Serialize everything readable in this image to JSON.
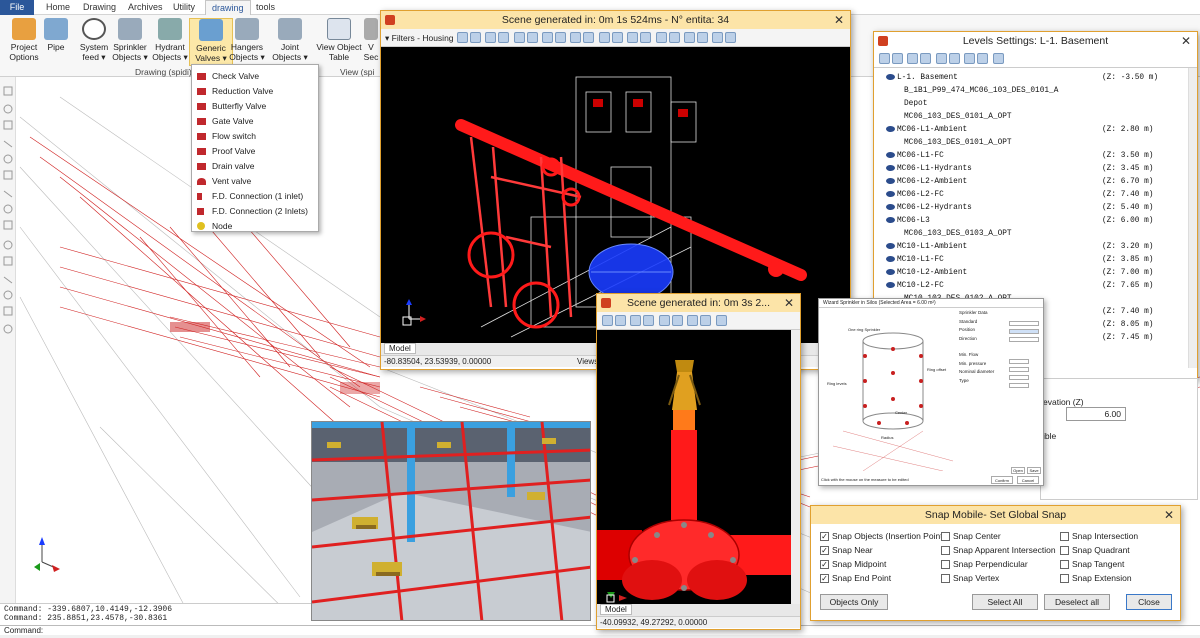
{
  "menubar": {
    "file": "File",
    "tabs": [
      "Home",
      "Drawing",
      "Archives",
      "Utility",
      "drawing",
      "tools"
    ]
  },
  "ribbon": {
    "buttons": [
      {
        "label": "Project Options"
      },
      {
        "label": "Pipe"
      },
      {
        "label": "System feed ▾"
      },
      {
        "label": "Sprinkler Objects ▾"
      },
      {
        "label": "Hydrant Objects ▾"
      },
      {
        "label": "Generic Valves ▾"
      },
      {
        "label": "Hangers Objects ▾"
      },
      {
        "label": "Joint Objects ▾"
      },
      {
        "label": "View Object Table"
      },
      {
        "label": "V Sec"
      }
    ],
    "group_label": "Drawing (spidi)",
    "group_label2": "View (spi"
  },
  "dropdown": {
    "items": [
      "Check Valve",
      "Reduction Valve",
      "Butterfly Valve",
      "Gate Valve",
      "Flow switch",
      "Proof Valve",
      "Drain valve",
      "Vent valve",
      "F.D. Connection (1 inlet)",
      "F.D. Connection (2 Inlets)",
      "Node"
    ]
  },
  "scene1": {
    "title": "Scene generated in: 0m 1s 524ms - N° entita: 34",
    "filter": "Filters - Housing",
    "tab": "Model",
    "coords": "-80.83504, 23.53939, 0.00000",
    "views": "Views"
  },
  "scene2": {
    "title": "Scene generated in: 0m 3s 2...",
    "tab": "Model",
    "coords": "-40.09932, 49.27292, 0.00000"
  },
  "levels": {
    "title": "Levels Settings: L-1. Basement",
    "rows": [
      {
        "name": "L-1. Basement",
        "z": "(Z: -3.50 m)"
      },
      {
        "name": "B_1B1_P99_474_MC06_103_DES_0101_A",
        "z": ""
      },
      {
        "name": "Depot",
        "z": ""
      },
      {
        "name": "MC06_103_DES_0101_A_OPT",
        "z": ""
      },
      {
        "name": "MC06-L1-Ambient",
        "z": "(Z:  2.80 m)"
      },
      {
        "name": "MC06_103_DES_0101_A_OPT",
        "z": ""
      },
      {
        "name": "MC06-L1-FC",
        "z": "(Z:  3.50 m)"
      },
      {
        "name": "MC06-L1-Hydrants",
        "z": "(Z:  3.45 m)"
      },
      {
        "name": "MC06-L2-Ambient",
        "z": "(Z:  6.70 m)"
      },
      {
        "name": "MC06-L2-FC",
        "z": "(Z:  7.40 m)"
      },
      {
        "name": "MC06-L2-Hydrants",
        "z": "(Z:  5.40 m)"
      },
      {
        "name": "MC06-L3",
        "z": "(Z:  6.00 m)"
      },
      {
        "name": "MC06_103_DES_0103_A_OPT",
        "z": ""
      },
      {
        "name": "MC10-L1-Ambient",
        "z": "(Z:  3.20 m)"
      },
      {
        "name": "MC10-L1-FC",
        "z": "(Z:  3.85 m)"
      },
      {
        "name": "MC10-L2-Ambient",
        "z": "(Z:  7.00 m)"
      },
      {
        "name": "MC10-L2-FC",
        "z": "(Z:  7.65 m)"
      },
      {
        "name": "MC10_103_DES_0102_A_OPT",
        "z": ""
      },
      {
        "name": "",
        "z": "(Z:  7.40 m)"
      },
      {
        "name": "",
        "z": "(Z:  8.05 m)"
      },
      {
        "name": "",
        "z": "(Z:  7.45 m)"
      }
    ],
    "elevation_label": "evation (Z)",
    "elevation_value": "6.00",
    "visible_label": "ible"
  },
  "wizard": {
    "title": "Wizard Sprinkler in Silos (Selected Area = 6.00 m²)",
    "fields": [
      "Sprinkler Data",
      "Standard",
      "Position",
      "Direction",
      "Min. Flow",
      "Min. pressure",
      "Nominal diameter",
      "Type"
    ],
    "hint": "Click with the mouse on the measure to be edited",
    "buttons": [
      "Open",
      "Save",
      "Confirm",
      "Cancel"
    ],
    "labels": [
      "One ring Sprinkler",
      "Ring offset",
      "Ring levels",
      "Center",
      "Radius"
    ]
  },
  "snap": {
    "title": "Snap Mobile- Set Global Snap",
    "options": [
      {
        "label": "Snap Objects (Insertion Point)",
        "checked": true
      },
      {
        "label": "Snap Near",
        "checked": true
      },
      {
        "label": "Snap Midpoint",
        "checked": true
      },
      {
        "label": "Snap End Point",
        "checked": true
      },
      {
        "label": "Snap Center",
        "checked": false
      },
      {
        "label": "Snap Apparent Intersection",
        "checked": false
      },
      {
        "label": "Snap Perpendicular",
        "checked": false
      },
      {
        "label": "Snap Vertex",
        "checked": false
      },
      {
        "label": "Snap Intersection",
        "checked": false
      },
      {
        "label": "Snap Quadrant",
        "checked": false
      },
      {
        "label": "Snap Tangent",
        "checked": false
      },
      {
        "label": "Snap Extension",
        "checked": false
      }
    ],
    "btn_objects_only": "Objects Only",
    "btn_select_all": "Select All",
    "btn_deselect_all": "Deselect all",
    "btn_close": "Close"
  },
  "command": {
    "line1": "Command: -339.6807,10.4149,-12.3906",
    "line2": "Command: 235.8851,23.4578,-30.8361",
    "prompt": "Command:"
  },
  "colors": {
    "accent": "#2b579a",
    "window_border": "#e0a030",
    "title_bg": "#fce4a8",
    "pipe_red": "#ff1a1a",
    "pump_blue": "#1a3cff"
  }
}
